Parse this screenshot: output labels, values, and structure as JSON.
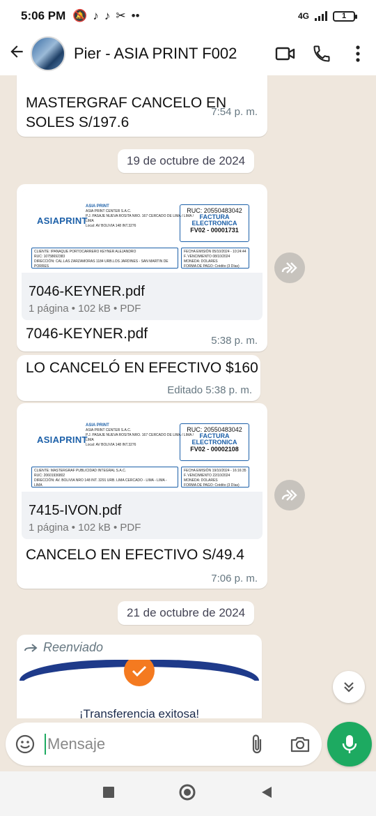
{
  "status_bar": {
    "time": "5:06 PM",
    "network": "4G",
    "battery": "1"
  },
  "header": {
    "contact_name": "Pier - ASIA PRINT F002"
  },
  "messages": {
    "m1": {
      "text": "MASTERGRAF CANCELO EN SOLES S/197.6",
      "time": "7:54 p. m."
    },
    "date1": "19 de octubre de 2024",
    "doc1": {
      "file_name": "7046-KEYNER.pdf",
      "meta": "1 página • 102 kB • PDF",
      "caption": "7046-KEYNER.pdf",
      "time": "5:38 p. m.",
      "preview": {
        "logo": "ASIAPRINT",
        "company": "ASIA PRINT",
        "company_full": "ASIA PRINT CENTER S.A.C.",
        "address": "P.J. PASAJE NUEVA ROSITA NRO. 167 CERCADO DE LIMA / LIMA / LIMA",
        "local": "Local: AV BOLIVIA 148 INT.3276",
        "ruc": "RUC: 20550483042",
        "doc_type": "FACTURA ELECTRONICA",
        "doc_number": "FV02 - 00001731",
        "client_label": "CLIENTE",
        "client": "IPANAQUE PORTOCARRERO KEYNER ALEJANDRO",
        "ruc_label": "RUC",
        "client_ruc": "10758692383",
        "dir_label": "DIRECCIÓN",
        "client_dir": "CAL.LAS ZARZAMORAS 1184 URB.LOS JARDINES - SAN MARTIN DE PORRES",
        "fecha_label": "FECHA EMISIÓN",
        "fecha": "05/10/2024 - 10:24:44",
        "venc_label": "F. VENCIMIENTO",
        "venc": "08/10/2024",
        "moneda_label": "MONEDA:",
        "moneda": "DOLARES",
        "pago_label": "FORMA DE PAGO:",
        "pago": "Crédito (3 Días)"
      }
    },
    "m2": {
      "text": "LO CANCELÓ EN EFECTIVO $160",
      "time": "Editado 5:38 p. m."
    },
    "doc2": {
      "file_name": "7415-IVON.pdf",
      "meta": "1 página • 102 kB • PDF",
      "caption": "CANCELO EN EFECTIVO S/49.4",
      "time": "7:06 p. m.",
      "preview": {
        "logo": "ASIAPRINT",
        "company": "ASIA PRINT",
        "company_full": "ASIA PRINT CENTER S.A.C.",
        "address": "P.J. PASAJE NUEVA ROSITA NRO. 167 CERCADO DE LIMA / LIMA / LIMA",
        "local": "Local: AV BOLIVIA 148 INT.3276",
        "ruc": "RUC: 20550483042",
        "doc_type": "FACTURA ELECTRONICA",
        "doc_number": "FV02 - 00002108",
        "client_label": "CLIENTE",
        "client": "MASTERGRAF PUBLICIDAD INTEGRAL S.A.C.",
        "ruc_label": "RUC",
        "client_ruc": "20601936802",
        "dir_label": "DIRECCIÓN",
        "client_dir": "AV. BOLIVIA NRO 148 INT. 3291 URB. LIMA CERCADO - LIMA - LIMA - LIMA",
        "fecha_label": "FECHA EMISIÓN",
        "fecha": "19/10/2024 - 16:16:35",
        "venc_label": "F. VENCIMIENTO",
        "venc": "22/10/2024",
        "moneda_label": "MONEDA:",
        "moneda": "DOLARES",
        "pago_label": "FORMA DE PAGO:",
        "pago": "Crédito (3 Días)"
      }
    },
    "date2": "21 de octubre de 2024",
    "m3": {
      "forwarded_label": "Reenviado",
      "image_text": "¡Transferencia exitosa!"
    }
  },
  "composer": {
    "placeholder": "Mensaje"
  },
  "colors": {
    "accent_green": "#1daa61",
    "chat_bg": "#efe7dd",
    "brand_blue": "#1b5fa8",
    "orange": "#f47a20"
  },
  "icons": [
    "back-arrow-icon",
    "video-call-icon",
    "phone-icon",
    "more-vert-icon",
    "forward-icon",
    "emoji-icon",
    "attach-icon",
    "camera-icon",
    "mic-icon",
    "scroll-down-icon"
  ]
}
